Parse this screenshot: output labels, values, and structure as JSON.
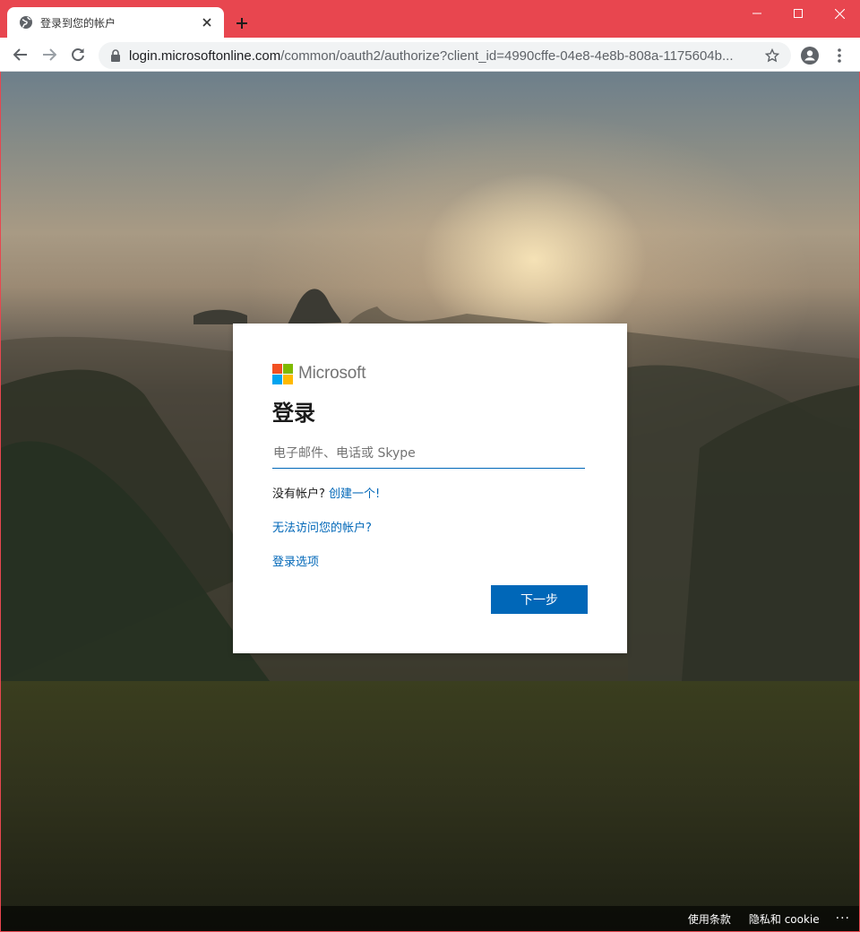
{
  "browser": {
    "tab_title": "登录到您的帐户",
    "url_host": "login.microsoftonline.com",
    "url_path": "/common/oauth2/authorize?client_id=4990cffe-04e8-4e8b-808a-1175604b...",
    "icons": {
      "tab": "globe-icon",
      "close_tab": "close-icon",
      "new_tab": "plus-icon",
      "back": "back-arrow-icon",
      "forward": "forward-arrow-icon",
      "reload": "reload-icon",
      "lock": "lock-icon",
      "bookmark": "star-icon",
      "profile": "account-icon",
      "menu": "kebab-menu-icon"
    },
    "colors": {
      "frame": "#e8464f"
    }
  },
  "signin": {
    "brand": "Microsoft",
    "title": "登录",
    "email_placeholder": "电子邮件、电话或 Skype",
    "no_account_text": "没有帐户?",
    "create_account_link": "创建一个!",
    "cant_access_link": "无法访问您的帐户?",
    "signin_options_link": "登录选项",
    "next_button": "下一步",
    "colors": {
      "accent": "#0067b8",
      "logo": [
        "#f25022",
        "#7fba00",
        "#00a4ef",
        "#ffb900"
      ]
    }
  },
  "footer": {
    "terms": "使用条款",
    "privacy": "隐私和 cookie",
    "more": "···"
  }
}
